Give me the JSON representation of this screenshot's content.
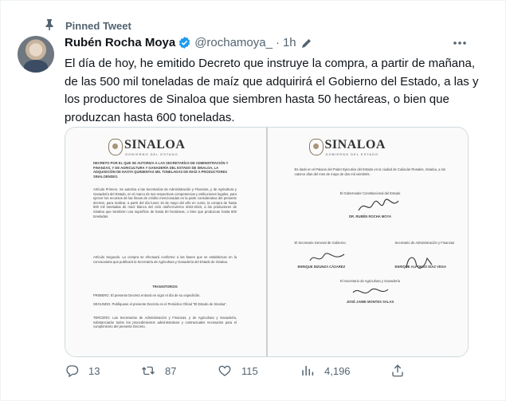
{
  "pinned": {
    "label": "Pinned Tweet"
  },
  "tweet": {
    "author_name": "Rubén Rocha Moya",
    "handle": "@rochamoya_",
    "separator": "·",
    "time": "1h",
    "text": "El día de hoy, he emitido Decreto que instruye la compra, a partir de mañana, de las 500 mil toneladas de maíz que adquirirá el Gobierno del Estado, a las y los productores de Sinaloa que siembren hasta 50 hectáreas, o bien que produzcan hasta 600 toneladas."
  },
  "media": {
    "left_page": {
      "brand": "SINALOA",
      "brand_sub": "GOBIERNO DEL ESTADO",
      "heading": "DECRETO POR EL QUE SE AUTORIZA A LAS SECRETARÍAS DE ADMINISTRACIÓN Y FINANZAS, Y DE AGRICULTURA Y GANADERÍA DEL ESTADO DE SINALOA, LA ADQUISICIÓN DE HASTA QUINIENTAS MIL TONELADAS DE MAÍZ A PRODUCTORES SINALOENSES.",
      "article1": "Artículo Primero. Se autoriza a las Secretarías de Administración y Finanzas, y de Agricultura y Ganadería del Estado, en el marco de sus respectivas competencias y atribuciones legales, para ejercer los recursos de las líneas de crédito mencionadas en la parte considerativa del presente decreto, para realizar, a partir del día lunes 15 de mayo del año en curso, la compra de hasta 500 mil toneladas de maíz blanco del ciclo otoño-invierno 2022-2023, a los productores de Sinaloa que siembren una superficie de hasta 50 hectáreas, o bien que produzcan hasta 600 toneladas.",
      "article2": "Artículo Segundo. La compra se efectuará conforme a las bases que se establezcan en la convocatoria que publicará la Secretaría de Agricultura y Ganadería del Estado de Sinaloa.",
      "transitorios": "TRANSITORIOS",
      "t1": "PRIMERO. El presente Decreto entrará en vigor el día de su expedición.",
      "t2": "SEGUNDO. Publíquese el presente Decreto en el Periódico Oficial \"El Estado de Sinaloa\".",
      "t3": "TERCERO. Las Secretarías de Administración y Finanzas, y de Agricultura y Ganadería, substanciarán todos los procedimientos administrativos y contractuales necesarios para el cumplimiento del presente Decreto."
    },
    "right_page": {
      "brand": "SINALOA",
      "brand_sub": "GOBIERNO DEL ESTADO",
      "intro": "Es dado en el Palacio del Poder Ejecutivo del Estado en la ciudad de Culiacán Rosales, Sinaloa, a los catorce días del mes de mayo de dos mil veintitrés.",
      "governor_title": "El Gobernador Constitucional del Estado",
      "governor_name": "DR. RUBÉN ROCHA MOYA",
      "sec_general_title": "El Secretario General de Gobierno",
      "sec_general_name": "ENRIQUE INZUNZA CÁZAREZ",
      "sec_finanzas_title": "Secretario de Administración y Finanzas",
      "sec_finanzas_name": "ENRIQUE ALFONSO DÍAZ VEGA",
      "sec_agricultura_title": "El Secretario de Agricultura y Ganadería",
      "sec_agricultura_name": "JOSÉ JAIME MONTES SALAS"
    }
  },
  "actions": {
    "replies": "13",
    "retweets": "87",
    "likes": "115",
    "views": "4,196"
  },
  "colors": {
    "accent": "#1d9bf0",
    "muted": "#536471",
    "text": "#0f1419"
  },
  "icons": [
    "pin-icon",
    "verified-badge-icon",
    "edit-icon",
    "more-icon",
    "reply-icon",
    "retweet-icon",
    "like-icon",
    "views-icon",
    "share-icon"
  ]
}
